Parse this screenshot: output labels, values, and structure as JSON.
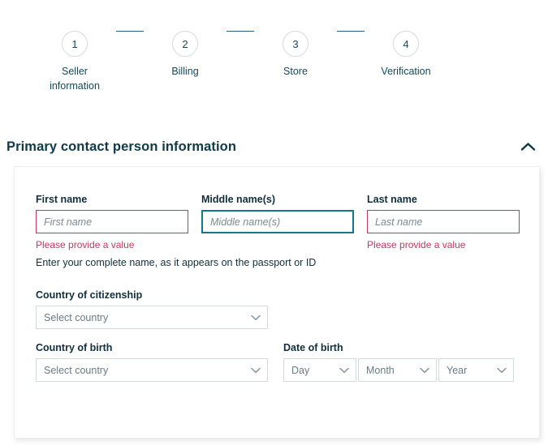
{
  "stepper": {
    "steps": [
      {
        "number": "1",
        "label": "Seller information"
      },
      {
        "number": "2",
        "label": "Billing"
      },
      {
        "number": "3",
        "label": "Store"
      },
      {
        "number": "4",
        "label": "Verification"
      }
    ]
  },
  "section": {
    "title": "Primary contact person information",
    "toggle_icon": "chevron-up-icon"
  },
  "form": {
    "first_name": {
      "label": "First name",
      "placeholder": "First name",
      "value": "",
      "error": "Please provide a value",
      "state": "error"
    },
    "middle_name": {
      "label": "Middle name(s)",
      "placeholder": "Middle name(s)",
      "value": "",
      "error": "",
      "state": "focused"
    },
    "last_name": {
      "label": "Last name",
      "placeholder": "Last name",
      "value": "",
      "error": "Please provide a value",
      "state": "error"
    },
    "helper_text": "Enter your complete name, as it appears on the passport or ID",
    "country_of_citizenship": {
      "label": "Country of citizenship",
      "selected": "Select country",
      "options": [
        "Select country"
      ]
    },
    "country_of_birth": {
      "label": "Country of birth",
      "selected": "Select country",
      "options": [
        "Select country"
      ]
    },
    "date_of_birth": {
      "label": "Date of birth",
      "day": {
        "selected": "Day",
        "options": [
          "Day"
        ]
      },
      "month": {
        "selected": "Month",
        "options": [
          "Month"
        ]
      },
      "year": {
        "selected": "Year",
        "options": [
          "Year"
        ]
      }
    }
  },
  "colors": {
    "error": "#c7385c",
    "focus": "#11788a",
    "heading": "#0f3a4a",
    "text": "#102e3e",
    "border": "#d5dbdb",
    "connector": "#2e5f7a"
  }
}
